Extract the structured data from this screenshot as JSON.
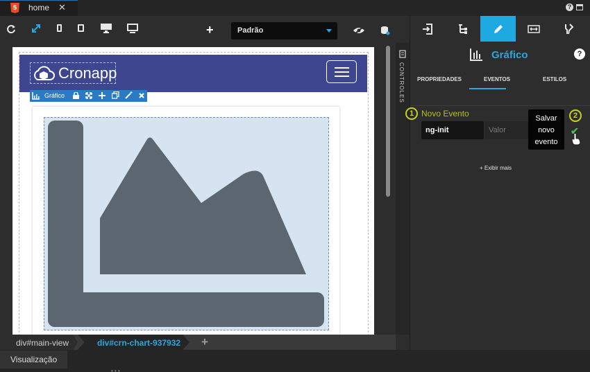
{
  "tabbar": {
    "tab_title": "home",
    "html5_badge": "5",
    "close_label": "✕",
    "help": "?"
  },
  "toolbar": {
    "add_label": "+",
    "viewport_select": "Padrão",
    "icons": [
      "refresh-icon",
      "expand-icon",
      "phone-icon",
      "tablet-icon",
      "desktop-icon",
      "monitor-icon",
      "visibility-icon",
      "database-icon"
    ]
  },
  "navbar": {
    "brand": "Cronapp"
  },
  "component_toolbar": {
    "label": "Gráfico"
  },
  "controls_strip": {
    "label": "CONTROLES"
  },
  "breadcrumbs": {
    "items": [
      "div#main-view",
      "div#crn-chart-937932"
    ],
    "add": "+"
  },
  "bottom": {
    "tab": "Visualização"
  },
  "right_panel": {
    "title": "Gráfico",
    "help": "?",
    "subtabs": [
      "PROPRIEDADES",
      "EVENTOS",
      "ESTILOS"
    ],
    "active_subtab": "EVENTOS",
    "step1": "1",
    "step2": "2",
    "new_event_label": "Novo Evento",
    "event_name_value": "ng-init",
    "event_value_placeholder": "Valor",
    "tooltip_lines": [
      "Salvar",
      "novo",
      "evento"
    ],
    "show_more": "+ Exibir mais"
  },
  "colors": {
    "accent": "#1fa9e1",
    "navbar": "#3f4690",
    "step": "#c8d21d",
    "check": "#45c04a"
  }
}
